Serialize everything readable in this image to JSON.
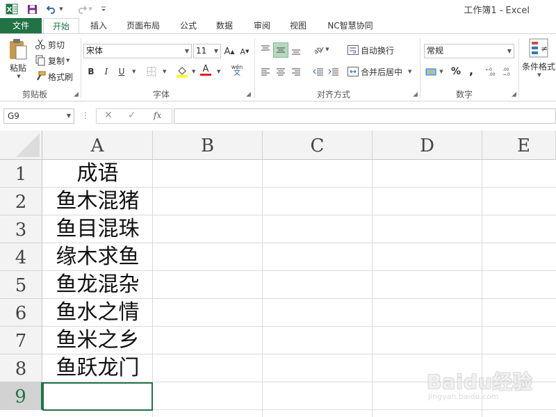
{
  "titlebar": {
    "window_title": "工作簿1 - Excel"
  },
  "tabs": {
    "file": "文件",
    "home": "开始",
    "insert": "插入",
    "layout": "页面布局",
    "formula": "公式",
    "data": "数据",
    "review": "审阅",
    "view": "视图",
    "nc": "NC智慧协同"
  },
  "ribbon": {
    "clipboard": {
      "label": "剪贴板",
      "paste": "粘贴",
      "cut": "剪切",
      "copy": "复制",
      "format_painter": "格式刷"
    },
    "font": {
      "label": "字体",
      "font_name": "宋体",
      "font_size": "11",
      "bold": "B",
      "italic": "I",
      "underline": "U",
      "grow": "A",
      "shrink": "A",
      "font_color": "A",
      "phonetic": "wén"
    },
    "alignment": {
      "label": "对齐方式",
      "wrap_text": "自动换行",
      "merge_center": "合并后居中"
    },
    "number": {
      "label": "数字",
      "number_format": "常规",
      "percent": "%",
      "comma": ","
    },
    "styles": {
      "conditional_format": "条件格式"
    }
  },
  "formula_bar": {
    "name_box": "G9",
    "fx": "fx",
    "value": ""
  },
  "sheet": {
    "columns": [
      "A",
      "B",
      "C",
      "D",
      "E"
    ],
    "rows": [
      "1",
      "2",
      "3",
      "4",
      "5",
      "6",
      "7",
      "8",
      "9"
    ],
    "cells_A": [
      "成语",
      "鱼木混猪",
      "鱼目混珠",
      "缘木求鱼",
      "鱼龙混杂",
      "鱼水之情",
      "鱼米之乡",
      "鱼跃龙门",
      ""
    ]
  },
  "watermark": {
    "text": "Baidu经验",
    "sub": "jingyan.baidu.com"
  },
  "colors": {
    "excel_green": "#217346",
    "header_bg": "#f3f3f3",
    "grid_line": "#dadada"
  }
}
